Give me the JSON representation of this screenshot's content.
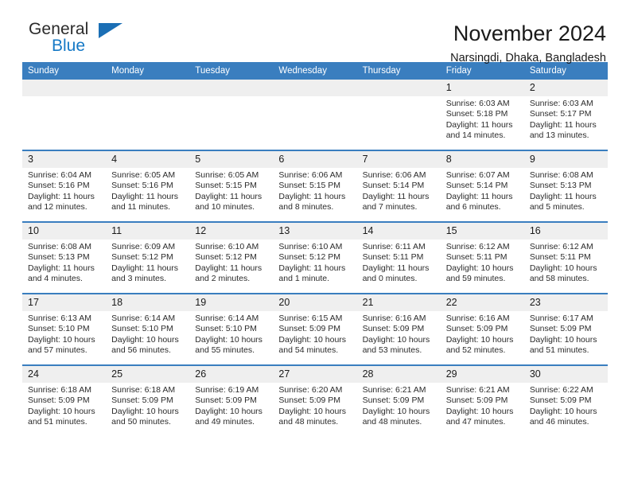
{
  "brand": {
    "line1": "General",
    "line2": "Blue",
    "triangle_icon": "triangle-logo-icon",
    "color_text": "#2b2b2b",
    "color_blue": "#1679c6"
  },
  "header": {
    "title": "November 2024",
    "subtitle": "Narsingdi, Dhaka, Bangladesh"
  },
  "theme": {
    "header_blue": "#3a7ebf",
    "daynum_gray": "#efefef",
    "text": "#2b2b2b"
  },
  "weekday_headers": [
    "Sunday",
    "Monday",
    "Tuesday",
    "Wednesday",
    "Thursday",
    "Friday",
    "Saturday"
  ],
  "weeks": [
    [
      {
        "day": "",
        "empty": true
      },
      {
        "day": "",
        "empty": true
      },
      {
        "day": "",
        "empty": true
      },
      {
        "day": "",
        "empty": true
      },
      {
        "day": "",
        "empty": true
      },
      {
        "day": "1",
        "sunrise": "Sunrise: 6:03 AM",
        "sunset": "Sunset: 5:18 PM",
        "daylight_line1": "Daylight: 11 hours",
        "daylight_line2": "and 14 minutes."
      },
      {
        "day": "2",
        "sunrise": "Sunrise: 6:03 AM",
        "sunset": "Sunset: 5:17 PM",
        "daylight_line1": "Daylight: 11 hours",
        "daylight_line2": "and 13 minutes."
      }
    ],
    [
      {
        "day": "3",
        "sunrise": "Sunrise: 6:04 AM",
        "sunset": "Sunset: 5:16 PM",
        "daylight_line1": "Daylight: 11 hours",
        "daylight_line2": "and 12 minutes."
      },
      {
        "day": "4",
        "sunrise": "Sunrise: 6:05 AM",
        "sunset": "Sunset: 5:16 PM",
        "daylight_line1": "Daylight: 11 hours",
        "daylight_line2": "and 11 minutes."
      },
      {
        "day": "5",
        "sunrise": "Sunrise: 6:05 AM",
        "sunset": "Sunset: 5:15 PM",
        "daylight_line1": "Daylight: 11 hours",
        "daylight_line2": "and 10 minutes."
      },
      {
        "day": "6",
        "sunrise": "Sunrise: 6:06 AM",
        "sunset": "Sunset: 5:15 PM",
        "daylight_line1": "Daylight: 11 hours",
        "daylight_line2": "and 8 minutes."
      },
      {
        "day": "7",
        "sunrise": "Sunrise: 6:06 AM",
        "sunset": "Sunset: 5:14 PM",
        "daylight_line1": "Daylight: 11 hours",
        "daylight_line2": "and 7 minutes."
      },
      {
        "day": "8",
        "sunrise": "Sunrise: 6:07 AM",
        "sunset": "Sunset: 5:14 PM",
        "daylight_line1": "Daylight: 11 hours",
        "daylight_line2": "and 6 minutes."
      },
      {
        "day": "9",
        "sunrise": "Sunrise: 6:08 AM",
        "sunset": "Sunset: 5:13 PM",
        "daylight_line1": "Daylight: 11 hours",
        "daylight_line2": "and 5 minutes."
      }
    ],
    [
      {
        "day": "10",
        "sunrise": "Sunrise: 6:08 AM",
        "sunset": "Sunset: 5:13 PM",
        "daylight_line1": "Daylight: 11 hours",
        "daylight_line2": "and 4 minutes."
      },
      {
        "day": "11",
        "sunrise": "Sunrise: 6:09 AM",
        "sunset": "Sunset: 5:12 PM",
        "daylight_line1": "Daylight: 11 hours",
        "daylight_line2": "and 3 minutes."
      },
      {
        "day": "12",
        "sunrise": "Sunrise: 6:10 AM",
        "sunset": "Sunset: 5:12 PM",
        "daylight_line1": "Daylight: 11 hours",
        "daylight_line2": "and 2 minutes."
      },
      {
        "day": "13",
        "sunrise": "Sunrise: 6:10 AM",
        "sunset": "Sunset: 5:12 PM",
        "daylight_line1": "Daylight: 11 hours",
        "daylight_line2": "and 1 minute."
      },
      {
        "day": "14",
        "sunrise": "Sunrise: 6:11 AM",
        "sunset": "Sunset: 5:11 PM",
        "daylight_line1": "Daylight: 11 hours",
        "daylight_line2": "and 0 minutes."
      },
      {
        "day": "15",
        "sunrise": "Sunrise: 6:12 AM",
        "sunset": "Sunset: 5:11 PM",
        "daylight_line1": "Daylight: 10 hours",
        "daylight_line2": "and 59 minutes."
      },
      {
        "day": "16",
        "sunrise": "Sunrise: 6:12 AM",
        "sunset": "Sunset: 5:11 PM",
        "daylight_line1": "Daylight: 10 hours",
        "daylight_line2": "and 58 minutes."
      }
    ],
    [
      {
        "day": "17",
        "sunrise": "Sunrise: 6:13 AM",
        "sunset": "Sunset: 5:10 PM",
        "daylight_line1": "Daylight: 10 hours",
        "daylight_line2": "and 57 minutes."
      },
      {
        "day": "18",
        "sunrise": "Sunrise: 6:14 AM",
        "sunset": "Sunset: 5:10 PM",
        "daylight_line1": "Daylight: 10 hours",
        "daylight_line2": "and 56 minutes."
      },
      {
        "day": "19",
        "sunrise": "Sunrise: 6:14 AM",
        "sunset": "Sunset: 5:10 PM",
        "daylight_line1": "Daylight: 10 hours",
        "daylight_line2": "and 55 minutes."
      },
      {
        "day": "20",
        "sunrise": "Sunrise: 6:15 AM",
        "sunset": "Sunset: 5:09 PM",
        "daylight_line1": "Daylight: 10 hours",
        "daylight_line2": "and 54 minutes."
      },
      {
        "day": "21",
        "sunrise": "Sunrise: 6:16 AM",
        "sunset": "Sunset: 5:09 PM",
        "daylight_line1": "Daylight: 10 hours",
        "daylight_line2": "and 53 minutes."
      },
      {
        "day": "22",
        "sunrise": "Sunrise: 6:16 AM",
        "sunset": "Sunset: 5:09 PM",
        "daylight_line1": "Daylight: 10 hours",
        "daylight_line2": "and 52 minutes."
      },
      {
        "day": "23",
        "sunrise": "Sunrise: 6:17 AM",
        "sunset": "Sunset: 5:09 PM",
        "daylight_line1": "Daylight: 10 hours",
        "daylight_line2": "and 51 minutes."
      }
    ],
    [
      {
        "day": "24",
        "sunrise": "Sunrise: 6:18 AM",
        "sunset": "Sunset: 5:09 PM",
        "daylight_line1": "Daylight: 10 hours",
        "daylight_line2": "and 51 minutes."
      },
      {
        "day": "25",
        "sunrise": "Sunrise: 6:18 AM",
        "sunset": "Sunset: 5:09 PM",
        "daylight_line1": "Daylight: 10 hours",
        "daylight_line2": "and 50 minutes."
      },
      {
        "day": "26",
        "sunrise": "Sunrise: 6:19 AM",
        "sunset": "Sunset: 5:09 PM",
        "daylight_line1": "Daylight: 10 hours",
        "daylight_line2": "and 49 minutes."
      },
      {
        "day": "27",
        "sunrise": "Sunrise: 6:20 AM",
        "sunset": "Sunset: 5:09 PM",
        "daylight_line1": "Daylight: 10 hours",
        "daylight_line2": "and 48 minutes."
      },
      {
        "day": "28",
        "sunrise": "Sunrise: 6:21 AM",
        "sunset": "Sunset: 5:09 PM",
        "daylight_line1": "Daylight: 10 hours",
        "daylight_line2": "and 48 minutes."
      },
      {
        "day": "29",
        "sunrise": "Sunrise: 6:21 AM",
        "sunset": "Sunset: 5:09 PM",
        "daylight_line1": "Daylight: 10 hours",
        "daylight_line2": "and 47 minutes."
      },
      {
        "day": "30",
        "sunrise": "Sunrise: 6:22 AM",
        "sunset": "Sunset: 5:09 PM",
        "daylight_line1": "Daylight: 10 hours",
        "daylight_line2": "and 46 minutes."
      }
    ]
  ]
}
